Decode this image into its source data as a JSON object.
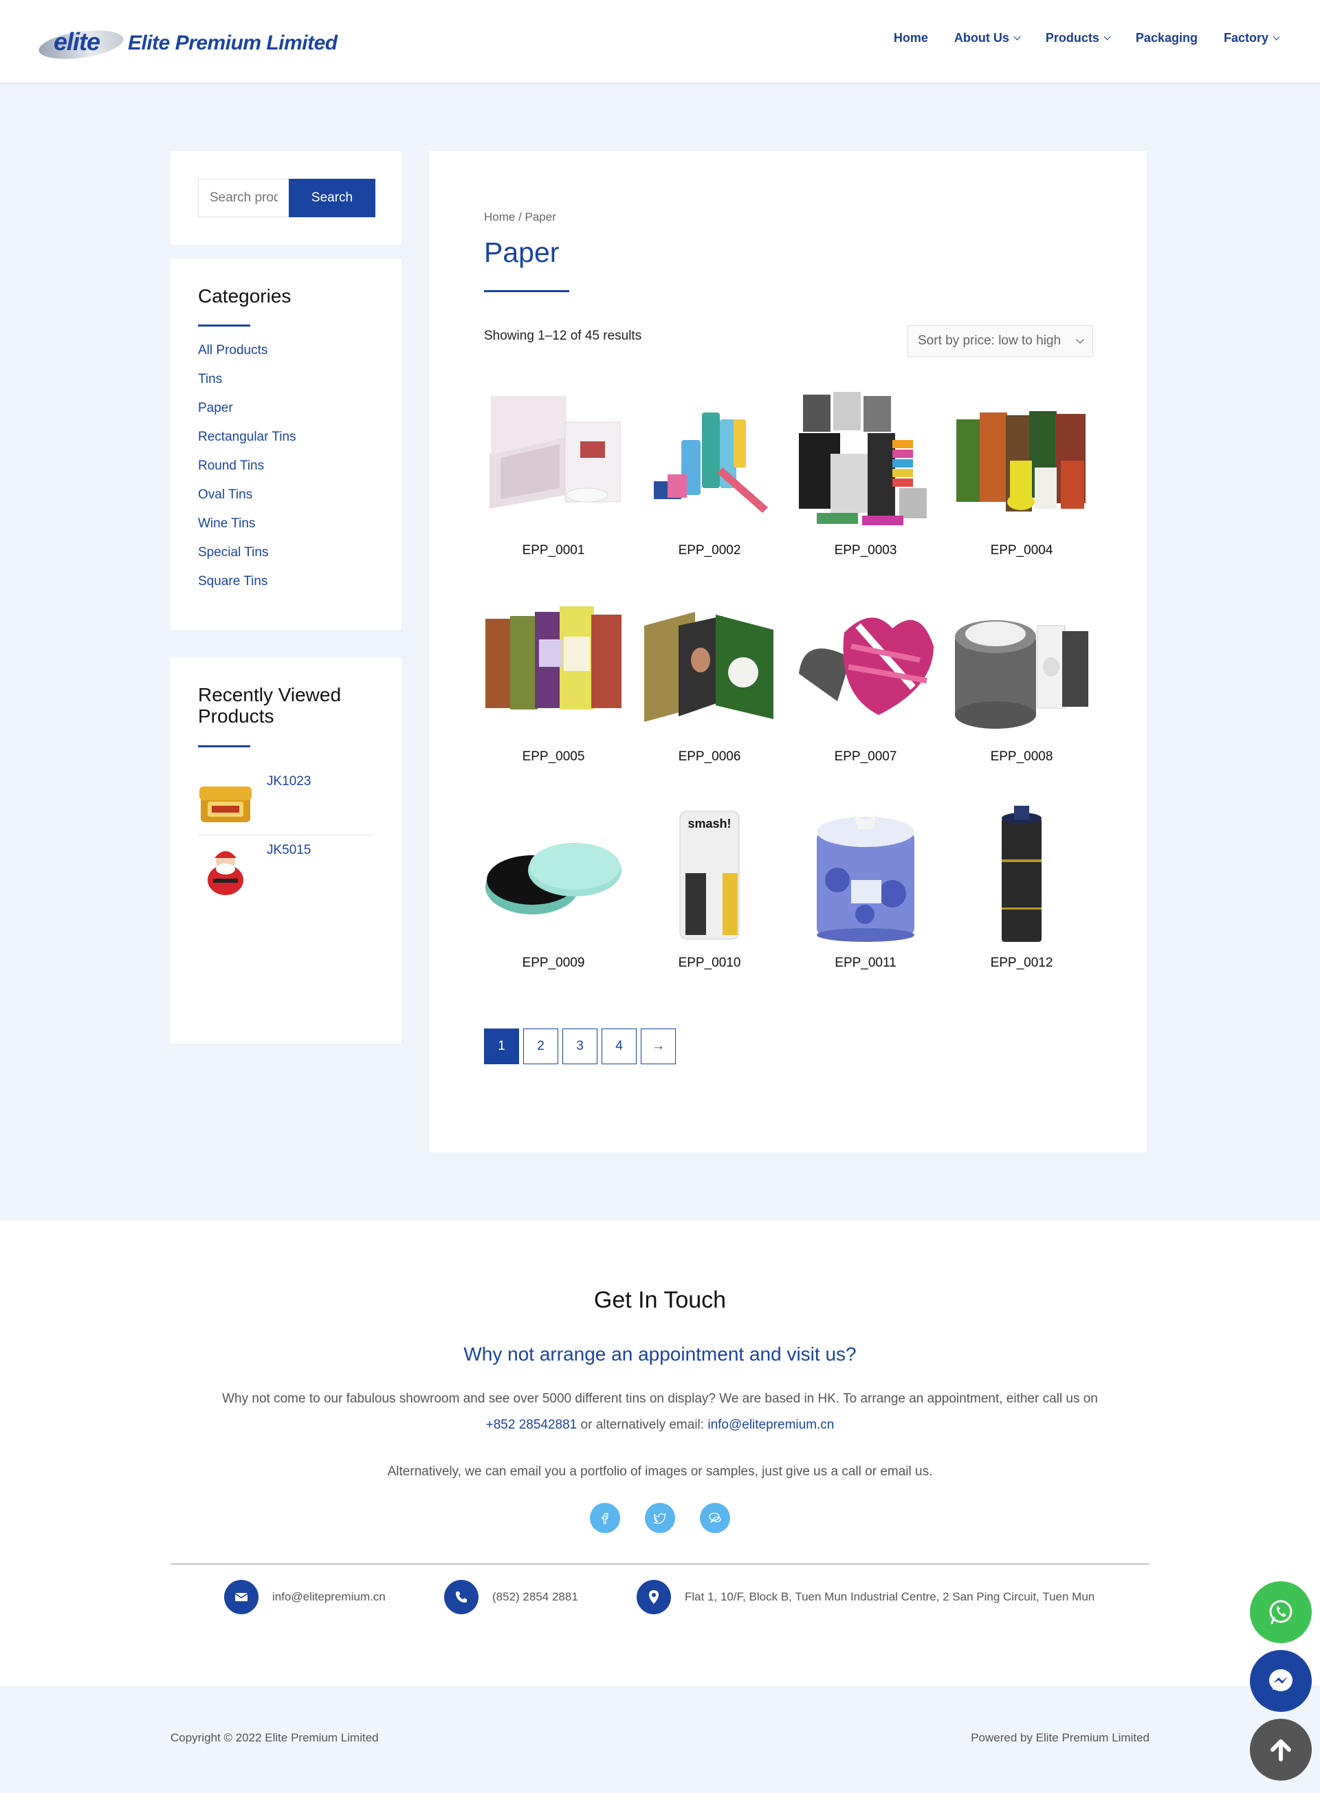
{
  "brand": {
    "logo_word": "elite",
    "name": "Elite Premium Limited"
  },
  "nav": {
    "items": [
      {
        "label": "Home",
        "dropdown": false
      },
      {
        "label": "About Us",
        "dropdown": true
      },
      {
        "label": "Products",
        "dropdown": true
      },
      {
        "label": "Packaging",
        "dropdown": false
      },
      {
        "label": "Factory",
        "dropdown": true
      }
    ]
  },
  "search": {
    "placeholder": "Search products…",
    "button_label": "Search"
  },
  "categories": {
    "title": "Categories",
    "items": [
      "All Products",
      "Tins",
      "Paper",
      "Rectangular Tins",
      "Round Tins",
      "Oval Tins",
      "Wine Tins",
      "Special Tins",
      "Square Tins"
    ]
  },
  "recently_viewed": {
    "title_line1": "Recently Viewed",
    "title_line2": "Products",
    "items": [
      {
        "name": "JK1023",
        "icon": "gold-tin-thumbnail"
      },
      {
        "name": "JK5015",
        "icon": "santa-tin-thumbnail"
      }
    ]
  },
  "main": {
    "breadcrumb": "Home / Paper",
    "title": "Paper",
    "result_count": "Showing 1–12 of 45 results",
    "sort_label": "Sort by price: low to high",
    "products": [
      {
        "name": "EPP_0001",
        "icon": "marble-gift-box"
      },
      {
        "name": "EPP_0002",
        "icon": "cosmetic-paper-tubes"
      },
      {
        "name": "EPP_0003",
        "icon": "photo-drawer-boxes"
      },
      {
        "name": "EPP_0004",
        "icon": "moravian-cookie-tubes"
      },
      {
        "name": "EPP_0005",
        "icon": "tea-paper-canisters"
      },
      {
        "name": "EPP_0006",
        "icon": "grass-book-box"
      },
      {
        "name": "EPP_0007",
        "icon": "pink-heart-box"
      },
      {
        "name": "EPP_0008",
        "icon": "round-pattern-boxes"
      },
      {
        "name": "EPP_0009",
        "icon": "mint-round-box"
      },
      {
        "name": "EPP_0010",
        "icon": "smash-paper-tube"
      },
      {
        "name": "EPP_0011",
        "icon": "blue-floral-hatbox"
      },
      {
        "name": "EPP_0012",
        "icon": "black-wine-tube"
      }
    ],
    "pagination": [
      "1",
      "2",
      "3",
      "4",
      "→"
    ],
    "current_page": "1"
  },
  "contact": {
    "title": "Get In Touch",
    "subtitle": "Why not arrange an appointment and visit us?",
    "text_part1": "Why not come to our fabulous showroom and see over 5000 different tins on display? We are based in HK. To arrange an appointment, either call us on",
    "phone_link": "+852 28542881",
    "text_part2": "or alternatively email:",
    "email_link": "info@elitepremium.cn",
    "text2": "Alternatively, we can email you a portfolio of images or samples, just give us a call or email us.",
    "social": [
      "facebook-icon",
      "twitter-icon",
      "chat-icon"
    ],
    "info": {
      "email": "info@elitepremium.cn",
      "phone": "(852) 2854 2881",
      "address": "Flat 1, 10/F, Block B, Tuen Mun Industrial Centre, 2 San Ping Circuit, Tuen Mun"
    }
  },
  "footer": {
    "copyright": "Copyright © 2022 Elite Premium Limited",
    "powered": "Powered by Elite Premium Limited"
  },
  "colors": {
    "brand": "#1b44a0",
    "background": "#f0f4fb",
    "social": "#5bb5ee",
    "whatsapp": "#3fc254",
    "scroll_top": "#555555"
  }
}
